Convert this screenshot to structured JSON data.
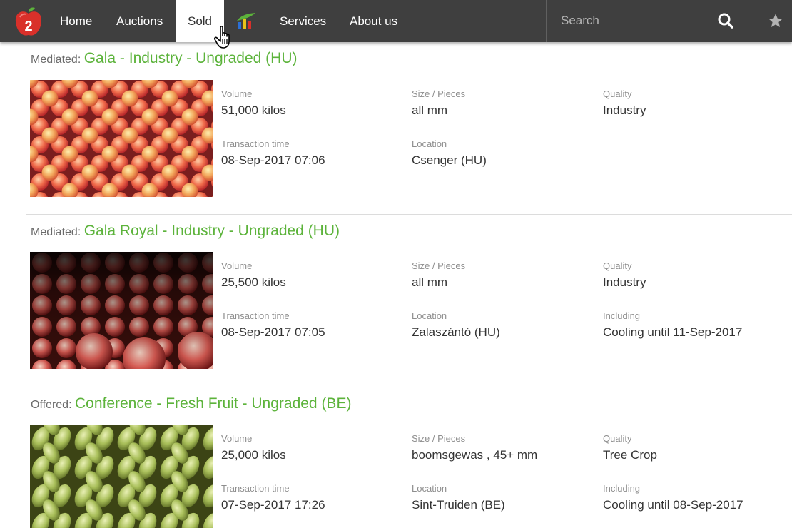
{
  "nav": {
    "items": [
      {
        "label": "Home"
      },
      {
        "label": "Auctions"
      },
      {
        "label": "Sold"
      },
      {
        "label": "Services"
      },
      {
        "label": "About us"
      }
    ],
    "logo_text": "2",
    "active": "Sold",
    "search_placeholder": "Search"
  },
  "labels": {
    "volume": "Volume",
    "size": "Size / Pieces",
    "quality": "Quality",
    "transaction_time": "Transaction time",
    "location": "Location",
    "including": "Including"
  },
  "listings": [
    {
      "prefix": "Mediated:",
      "title": "Gala - Industry - Ungraded (HU)",
      "volume": "51,000 kilos",
      "size": "all mm",
      "quality": "Industry",
      "transaction_time": "08-Sep-2017 07:06",
      "location": "Csenger (HU)"
    },
    {
      "prefix": "Mediated:",
      "title": "Gala Royal - Industry - Ungraded (HU)",
      "volume": "25,500 kilos",
      "size": "all mm",
      "quality": "Industry",
      "transaction_time": "08-Sep-2017 07:05",
      "location": "Zalaszántó (HU)",
      "including": "Cooling until 11-Sep-2017"
    },
    {
      "prefix": "Offered:",
      "title": "Conference - Fresh Fruit - Ungraded (BE)",
      "volume": "25,000 kilos",
      "size": "boomsgewas , 45+ mm",
      "quality": "Tree Crop",
      "transaction_time": "07-Sep-2017 17:26",
      "location": "Sint-Truiden (BE)",
      "including": "Cooling until 08-Sep-2017"
    }
  ],
  "colors": {
    "navbar": "#3f3f3f",
    "title_green": "#5cb33b",
    "logo_red": "#d9302a"
  },
  "icons": [
    "apple-logo-icon",
    "chart-icon",
    "search-icon",
    "star-icon",
    "hand-pointer-cursor-icon"
  ]
}
